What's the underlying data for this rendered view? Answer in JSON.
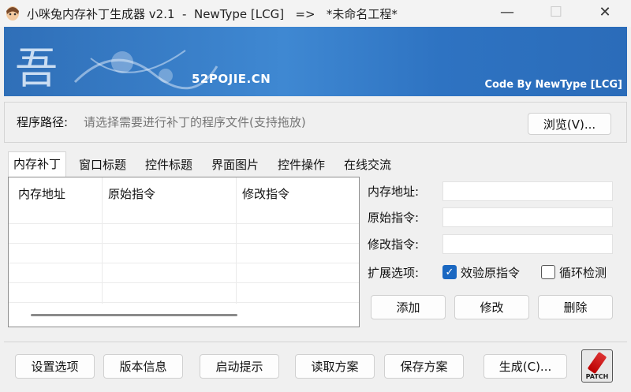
{
  "window": {
    "title": "小咪兔内存补丁生成器 v2.1  -  NewType [LCG]   =>   *未命名工程*",
    "min_glyph": "—",
    "max_glyph": "☐",
    "close_glyph": "✕"
  },
  "banner": {
    "logo_glyph": "吾",
    "site": "52POJIE.CN",
    "credit": "Code By NewType [LCG]"
  },
  "path": {
    "label": "程序路径:",
    "placeholder": "请选择需要进行补丁的程序文件(支持拖放)",
    "browse_label": "浏览(V)..."
  },
  "tabs": [
    "内存补丁",
    "窗口标题",
    "控件标题",
    "界面图片",
    "控件操作",
    "在线交流"
  ],
  "table": {
    "columns": [
      "内存地址",
      "原始指令",
      "修改指令"
    ],
    "rows": []
  },
  "form": {
    "address_label": "内存地址:",
    "original_label": "原始指令:",
    "modified_label": "修改指令:",
    "address_value": "",
    "original_value": "",
    "modified_value": "",
    "options_label": "扩展选项:",
    "verify_label": "效验原指令",
    "verify_checked": true,
    "loop_label": "循环检测",
    "loop_checked": false,
    "add_label": "添加",
    "edit_label": "修改",
    "delete_label": "删除"
  },
  "bottom": {
    "settings_label": "设置选项",
    "version_label": "版本信息",
    "startup_label": "启动提示",
    "load_label": "读取方案",
    "save_label": "保存方案",
    "generate_label": "生成(C)...",
    "patch_icon_text": "PATCH"
  },
  "colors": {
    "accent": "#1a67c1",
    "banner": "#3f88d2"
  }
}
